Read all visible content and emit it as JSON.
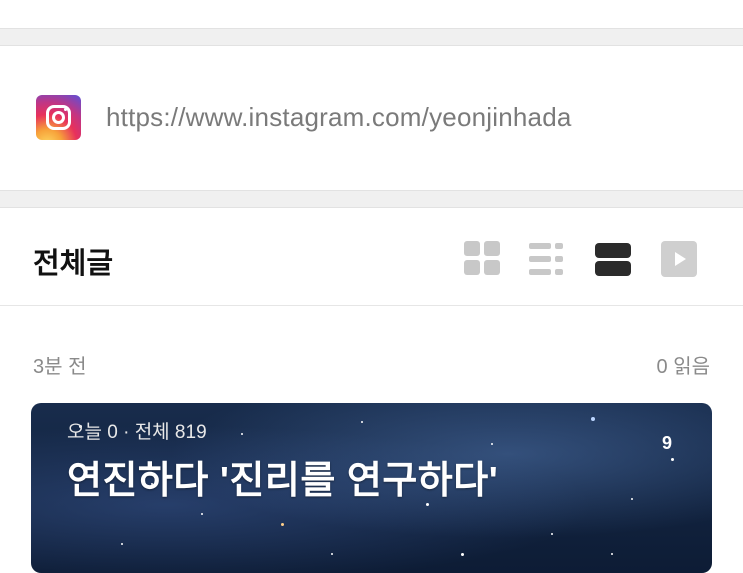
{
  "instagram": {
    "icon": "instagram-icon",
    "url": "https://www.instagram.com/yeonjinhada"
  },
  "section": {
    "title": "전체글",
    "view_modes": [
      "grid-view-icon",
      "list-view-icon",
      "card-view-icon",
      "video-view-icon"
    ],
    "active_view": "card-view-icon"
  },
  "post": {
    "time": "3분 전",
    "reads": "0 읽음",
    "cover": {
      "stats": "오늘 0 · 전체 819",
      "title": "연진하다 '진리를 연구하다'",
      "badge": "9"
    }
  },
  "colors": {
    "title_text": "#111111",
    "muted_text": "#8a8a8a",
    "active_icon": "#2b2b2b",
    "inactive_icon": "#c8c8c8"
  }
}
